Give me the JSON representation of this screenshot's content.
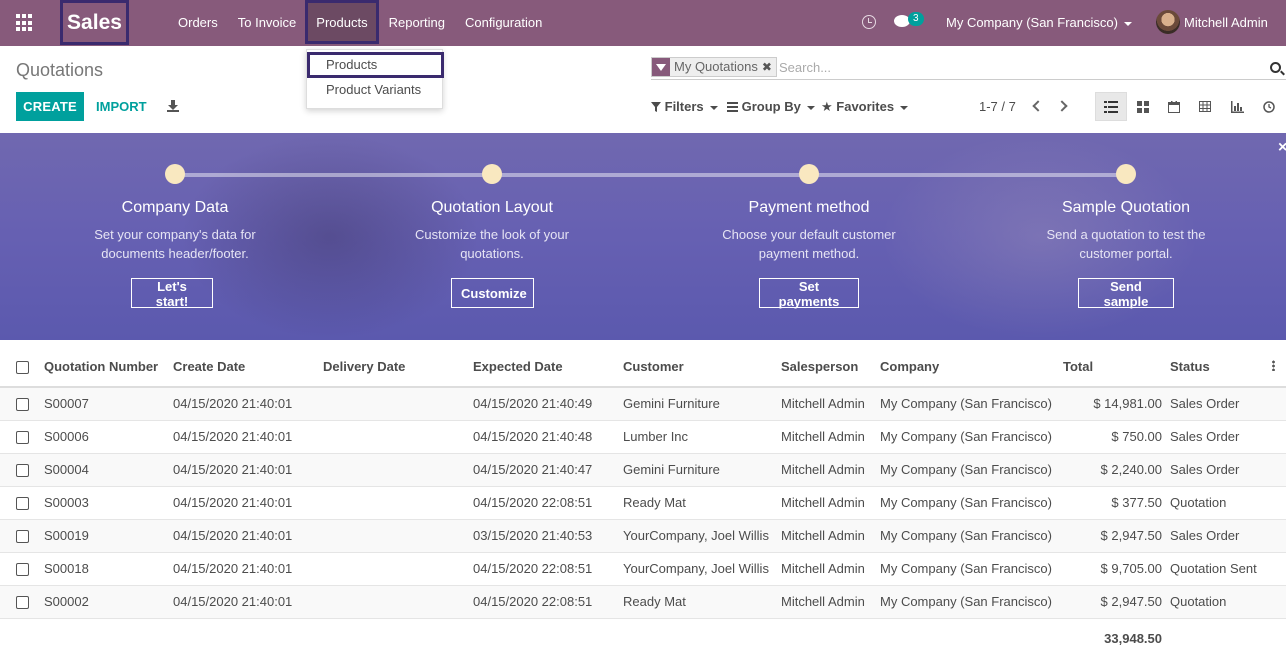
{
  "navbar": {
    "brand": "Sales",
    "menu": [
      "Orders",
      "To Invoice",
      "Products",
      "Reporting",
      "Configuration"
    ],
    "active_menu": "Products",
    "chat_count": "3",
    "company": "My Company (San Francisco)",
    "user": "Mitchell Admin",
    "bg_color": "#875a7b"
  },
  "dropdown": {
    "items": [
      "Products",
      "Product Variants"
    ]
  },
  "control": {
    "title": "Quotations",
    "create_label": "CREATE",
    "import_label": "IMPORT",
    "facet_label": "My Quotations",
    "facet_remove": "✖",
    "search_placeholder": "Search...",
    "filters_label": "Filters",
    "groupby_label": "Group By",
    "favorites_label": "Favorites",
    "pager": "1-7 / 7",
    "views": [
      "list-icon",
      "kanban-icon",
      "calendar-icon",
      "pivot-icon",
      "graph-icon",
      "activity-icon"
    ]
  },
  "banner": {
    "steps": [
      {
        "title": "Company Data",
        "desc": "Set your company's data for documents header/footer.",
        "button": "Let's start!"
      },
      {
        "title": "Quotation Layout",
        "desc": "Customize the look of your quotations.",
        "button": "Customize"
      },
      {
        "title": "Payment method",
        "desc": "Choose your default customer payment method.",
        "button": "Set payments"
      },
      {
        "title": "Sample Quotation",
        "desc": "Send a quotation to test the customer portal.",
        "button": "Send sample"
      }
    ],
    "close": "×"
  },
  "table": {
    "columns": [
      "Quotation Number",
      "Create Date",
      "Delivery Date",
      "Expected Date",
      "Customer",
      "Salesperson",
      "Company",
      "Total",
      "Status"
    ],
    "rows": [
      [
        "S00007",
        "04/15/2020 21:40:01",
        "",
        "04/15/2020 21:40:49",
        "Gemini Furniture",
        "Mitchell Admin",
        "My Company (San Francisco)",
        "$ 14,981.00",
        "Sales Order"
      ],
      [
        "S00006",
        "04/15/2020 21:40:01",
        "",
        "04/15/2020 21:40:48",
        "Lumber Inc",
        "Mitchell Admin",
        "My Company (San Francisco)",
        "$ 750.00",
        "Sales Order"
      ],
      [
        "S00004",
        "04/15/2020 21:40:01",
        "",
        "04/15/2020 21:40:47",
        "Gemini Furniture",
        "Mitchell Admin",
        "My Company (San Francisco)",
        "$ 2,240.00",
        "Sales Order"
      ],
      [
        "S00003",
        "04/15/2020 21:40:01",
        "",
        "04/15/2020 22:08:51",
        "Ready Mat",
        "Mitchell Admin",
        "My Company (San Francisco)",
        "$ 377.50",
        "Quotation"
      ],
      [
        "S00019",
        "04/15/2020 21:40:01",
        "",
        "03/15/2020 21:40:53",
        "YourCompany, Joel Willis",
        "Mitchell Admin",
        "My Company (San Francisco)",
        "$ 2,947.50",
        "Sales Order"
      ],
      [
        "S00018",
        "04/15/2020 21:40:01",
        "",
        "04/15/2020 22:08:51",
        "YourCompany, Joel Willis",
        "Mitchell Admin",
        "My Company (San Francisco)",
        "$ 9,705.00",
        "Quotation Sent"
      ],
      [
        "S00002",
        "04/15/2020 21:40:01",
        "",
        "04/15/2020 22:08:51",
        "Ready Mat",
        "Mitchell Admin",
        "My Company (San Francisco)",
        "$ 2,947.50",
        "Quotation"
      ]
    ],
    "total": "33,948.50"
  }
}
